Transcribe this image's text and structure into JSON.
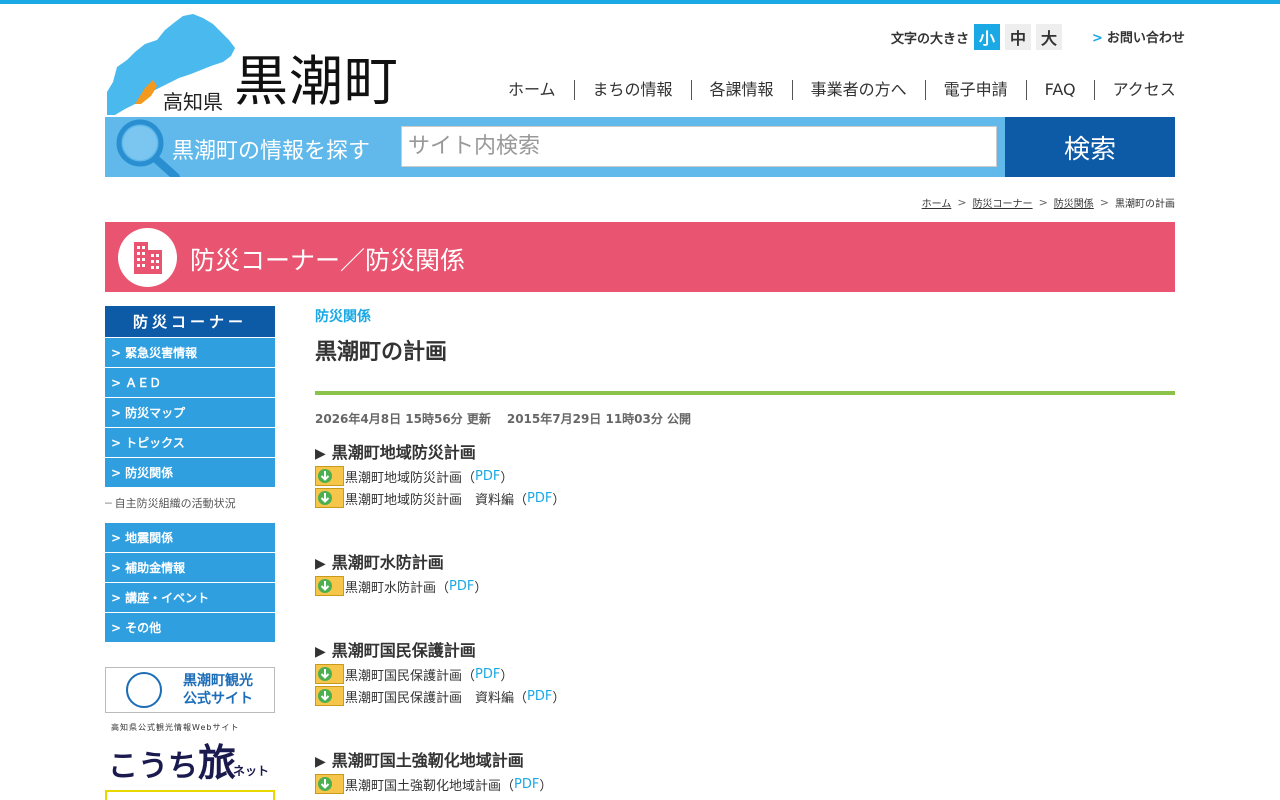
{
  "header": {
    "pref": "高知県",
    "town": "黒潮町",
    "font_size_label": "文字の大きさ",
    "font_sizes": [
      "小",
      "中",
      "大"
    ],
    "active_font_size": "小",
    "contact": "お問い合わせ",
    "nav": [
      "ホーム",
      "まちの情報",
      "各課情報",
      "事業者の方へ",
      "電子申請",
      "FAQ",
      "アクセス"
    ]
  },
  "search": {
    "label": "黒潮町の情報を探す",
    "placeholder": "サイト内検索",
    "button": "検索"
  },
  "breadcrumb": [
    "ホーム",
    "防災コーナー",
    "防災関係",
    "黒潮町の計画"
  ],
  "category_banner": {
    "title": "防災コーナー／防災関係"
  },
  "sidebar": {
    "heading": "防災コーナー",
    "items": [
      "緊急災害情報",
      "ＡＥＤ",
      "防災マップ",
      "トピックス",
      "防災関係"
    ],
    "sub_items": [
      "自主防災組織の活動状況"
    ],
    "items2": [
      "地震関係",
      "補助金情報",
      "講座・イベント",
      "その他"
    ],
    "banners": {
      "tourism_line1": "黒潮町観光",
      "tourism_line2": "公式サイト",
      "tabi_small": "高知県公式観光情報Webサイト",
      "tabi_big1": "こうち",
      "tabi_big2": "旅",
      "tabi_net": "ネット"
    }
  },
  "main": {
    "category": "防災関係",
    "title": "黒潮町の計画",
    "updated": "2026年4月8日 15時56分 更新",
    "published": "2015年7月29日 11時03分 公開",
    "sections": [
      {
        "heading": "黒潮町地域防災計画",
        "files": [
          {
            "name": "黒潮町地域防災計画",
            "format": "PDF"
          },
          {
            "name": "黒潮町地域防災計画　資料編",
            "format": "PDF"
          }
        ]
      },
      {
        "heading": "黒潮町水防計画",
        "files": [
          {
            "name": "黒潮町水防計画",
            "format": "PDF"
          }
        ]
      },
      {
        "heading": "黒潮町国民保護計画",
        "files": [
          {
            "name": "黒潮町国民保護計画",
            "format": "PDF"
          },
          {
            "name": "黒潮町国民保護計画　資料編",
            "format": "PDF"
          }
        ]
      },
      {
        "heading": "黒潮町国土強靭化地域計画",
        "files": [
          {
            "name": "黒潮町国土強靭化地域計画",
            "format": "PDF"
          }
        ]
      }
    ]
  },
  "colors": {
    "accent": "#1aa9e4",
    "nav_dark": "#0d5aa7",
    "banner": "#e95470",
    "rule": "#8bc34a",
    "sidebar": "#2f9fe0"
  },
  "icons": [
    "kochi-map-logo",
    "search-icon",
    "building-icon",
    "download-icon"
  ]
}
